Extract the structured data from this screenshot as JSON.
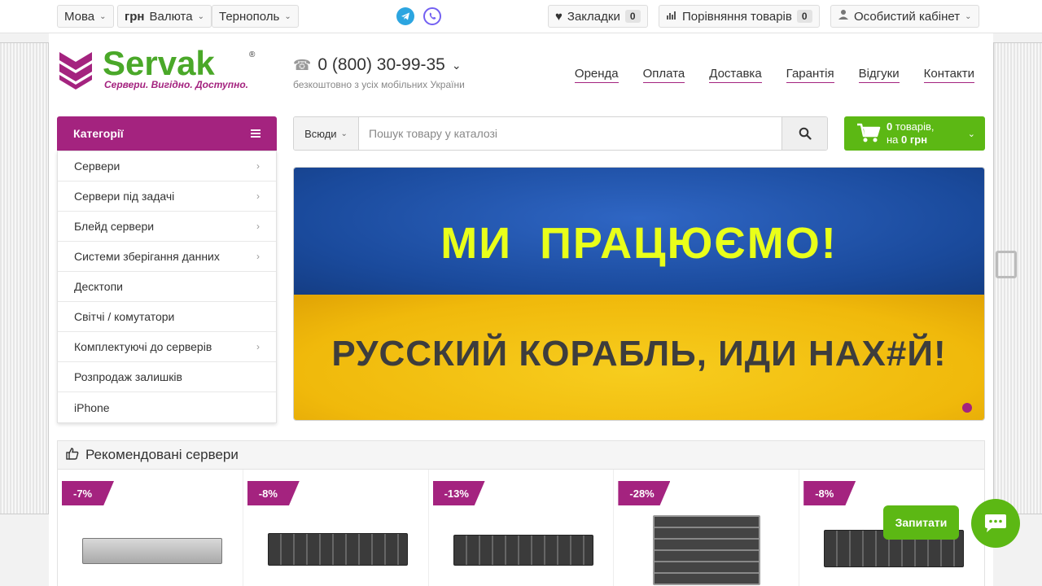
{
  "topbar": {
    "language_label": "Мова",
    "currency_bold": "грн",
    "currency_label": "Валюта",
    "city": "Тернополь",
    "social": [
      "telegram-icon",
      "viber-icon"
    ],
    "bookmarks_label": "Закладки",
    "bookmarks_count": "0",
    "compare_label": "Порівняння товарів",
    "compare_count": "0",
    "account_label": "Особистий кабінет"
  },
  "logo": {
    "name": "Servak",
    "reg": "®",
    "tagline": "Сервери. Вигідно. Доступно."
  },
  "phone": {
    "number": "0 (800) 30-99-35",
    "subtitle": "безкоштовно з усіх мобільних України"
  },
  "nav": [
    "Оренда",
    "Оплата",
    "Доставка",
    "Гарантія",
    "Відгуки",
    "Контакти"
  ],
  "categories": {
    "title": "Категорії",
    "items": [
      {
        "label": "Сервери",
        "arrow": true
      },
      {
        "label": "Сервери під задачі",
        "arrow": true
      },
      {
        "label": "Блейд сервери",
        "arrow": true
      },
      {
        "label": "Системи зберігання данних",
        "arrow": true
      },
      {
        "label": "Десктопи",
        "arrow": false
      },
      {
        "label": "Світчі / комутатори",
        "arrow": false
      },
      {
        "label": "Комплектуючі до серверів",
        "arrow": true
      },
      {
        "label": "Розпродаж залишків",
        "arrow": false
      },
      {
        "label": "iPhone",
        "arrow": false
      }
    ]
  },
  "search": {
    "scope": "Всюди",
    "placeholder": "Пошук товару у каталозі"
  },
  "cart": {
    "count_bold": "0",
    "count_text": "товарів,",
    "total_prefix": "на",
    "total_bold": "0 грн"
  },
  "banner": {
    "line1": "МИ  ПРАЦЮЄМО!",
    "line2": "РУССКИЙ КОРАБЛЬ, ИДИ НАХ#Й!"
  },
  "recommended": {
    "title": "Рекомендовані сервери",
    "products": [
      {
        "discount": "-7%"
      },
      {
        "discount": "-8%"
      },
      {
        "discount": "-13%"
      },
      {
        "discount": "-28%"
      },
      {
        "discount": "-8%"
      }
    ]
  },
  "chat": {
    "ask_label": "Запитати"
  },
  "colors": {
    "brand_purple": "#a4237f",
    "brand_green": "#5cb814",
    "logo_green": "#4aa829",
    "flag_blue": "#1a4a9c",
    "flag_yellow": "#f0b90b"
  }
}
